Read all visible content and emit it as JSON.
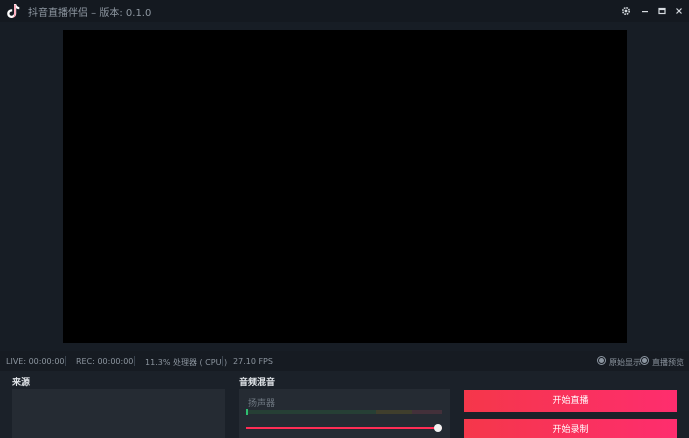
{
  "titlebar": {
    "title": "抖音直播伴侣 – 版本: 0.1.0",
    "icons": {
      "logo": "tiktok-logo",
      "settings": "gear-icon",
      "minimize": "minimize-icon",
      "maximize": "maximize-icon",
      "close": "close-icon"
    }
  },
  "status": {
    "live": "LIVE: 00:00:00",
    "rec": "REC: 00:00:00",
    "cpu": "11.3% 处理器 ( CPU )",
    "fps": "27.10 FPS",
    "option_1": "原始显示",
    "option_2": "直播预览"
  },
  "sources": {
    "title": "来源"
  },
  "audio": {
    "title": "音频混音",
    "mic_label": "扬声器",
    "volume": 1.0
  },
  "actions": {
    "start_live": "开始直播",
    "start_record": "开始录制"
  },
  "colors": {
    "accent": "#fe2c55",
    "preview_bg": "#000000",
    "panel_bg": "#252b33"
  }
}
